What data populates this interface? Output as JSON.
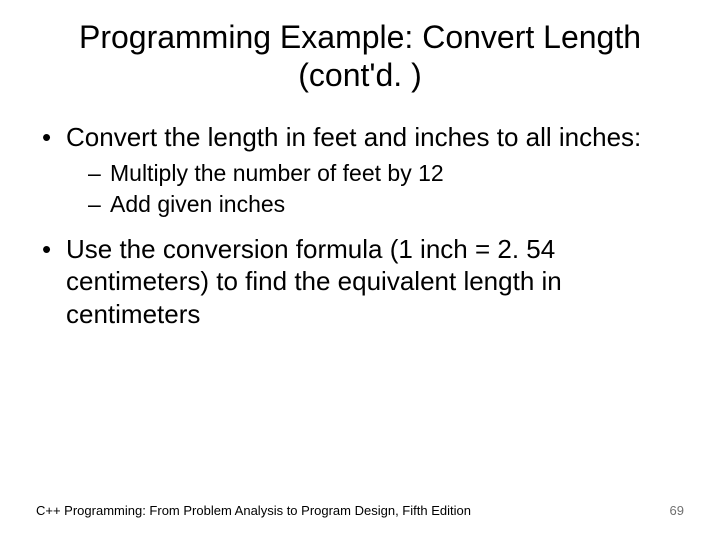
{
  "title": "Programming Example: Convert Length (cont'd. )",
  "bullets": [
    {
      "text": "Convert the length in feet and inches to all inches:",
      "sub": [
        "Multiply the number of feet by 12",
        "Add given inches"
      ]
    },
    {
      "text": "Use the conversion formula (1 inch = 2. 54 centimeters) to find the equivalent length in centimeters",
      "sub": []
    }
  ],
  "footer": {
    "source": "C++ Programming: From Problem Analysis to Program Design, Fifth Edition",
    "page": "69"
  }
}
